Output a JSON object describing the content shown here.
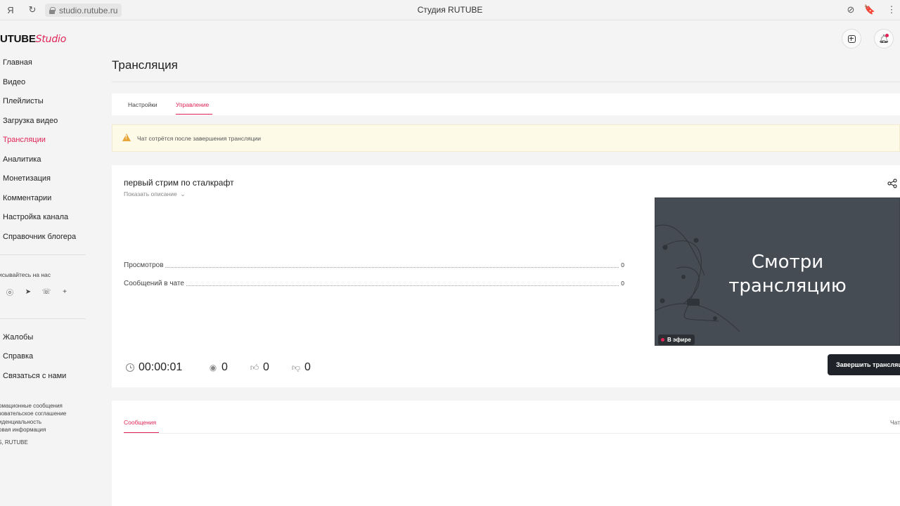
{
  "browser": {
    "url": "studio.rutube.ru",
    "title": "Студия RUTUBE"
  },
  "logo": {
    "brand": "UTUBE",
    "product": "Studio"
  },
  "sidebar": {
    "items": [
      {
        "label": "Главная"
      },
      {
        "label": "Видео"
      },
      {
        "label": "Плейлисты"
      },
      {
        "label": "Загрузка видео"
      },
      {
        "label": "Трансляции",
        "active": true
      },
      {
        "label": "Аналитика"
      },
      {
        "label": "Монетизация"
      },
      {
        "label": "Комментарии"
      },
      {
        "label": "Настройка канала"
      },
      {
        "label": "Справочник блогера"
      }
    ],
    "follow_label": "исывайтесь на нас",
    "social_icons": [
      "odnoklassniki-icon",
      "telegram-icon",
      "viber-icon",
      "more-icon"
    ],
    "support_items": [
      {
        "label": "Жалобы"
      },
      {
        "label": "Справка"
      },
      {
        "label": "Связаться с нами"
      }
    ],
    "legal": [
      "рмационные сообщения",
      "зовательское соглашение",
      "иденциальность",
      "овая информация"
    ],
    "copyright": "5, RUTUBE"
  },
  "page": {
    "title": "Трансляция"
  },
  "tabs": [
    {
      "label": "Настройки"
    },
    {
      "label": "Управление",
      "active": true
    }
  ],
  "warning": {
    "text": "Чат сотрётся после завершения трансляции"
  },
  "stream": {
    "title": "первый стрим по сталкрафт",
    "show_description": "Показать описание",
    "stats": [
      {
        "label": "Просмотров",
        "value": "0"
      },
      {
        "label": "Сообщений в чате",
        "value": "0"
      }
    ],
    "preview_text_line1": "Смотри",
    "preview_text_line2": "трансляцию",
    "live_label": "В эфире",
    "metrics": {
      "duration": "00:00:01",
      "viewers": "0",
      "likes": "0",
      "dislikes": "0"
    },
    "end_button": "Завершить трансляцию"
  },
  "messages": {
    "tab_label": "Сообщения",
    "right_label": "Чат"
  },
  "colors": {
    "accent": "#e02456",
    "warning_bg": "#fdfae8",
    "preview_bg": "#464c54",
    "button_dark": "#1f2329"
  }
}
